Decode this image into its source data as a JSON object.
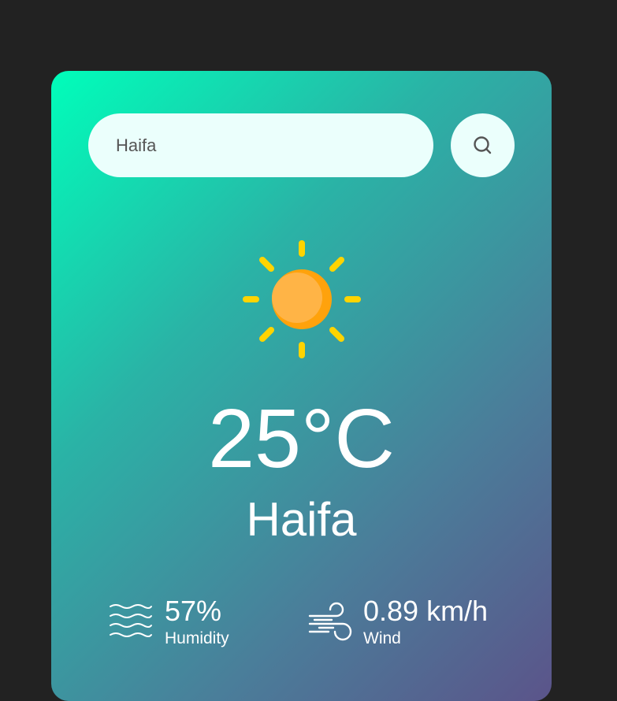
{
  "search": {
    "value": "Haifa",
    "placeholder": ""
  },
  "weather": {
    "icon": "sun-icon",
    "temperature": "25°C",
    "city": "Haifa"
  },
  "details": {
    "humidity": {
      "icon": "humidity-icon",
      "value": "57%",
      "label": "Humidity"
    },
    "wind": {
      "icon": "wind-icon",
      "value": "0.89 km/h",
      "label": "Wind"
    }
  },
  "colors": {
    "background": "#222222",
    "gradient_start": "#00feba",
    "gradient_end": "#5b548a",
    "input_bg": "#ebfffc",
    "sun_body": "#ffb446",
    "sun_shadow": "#ffa20c",
    "sun_rays": "#ffd400"
  }
}
